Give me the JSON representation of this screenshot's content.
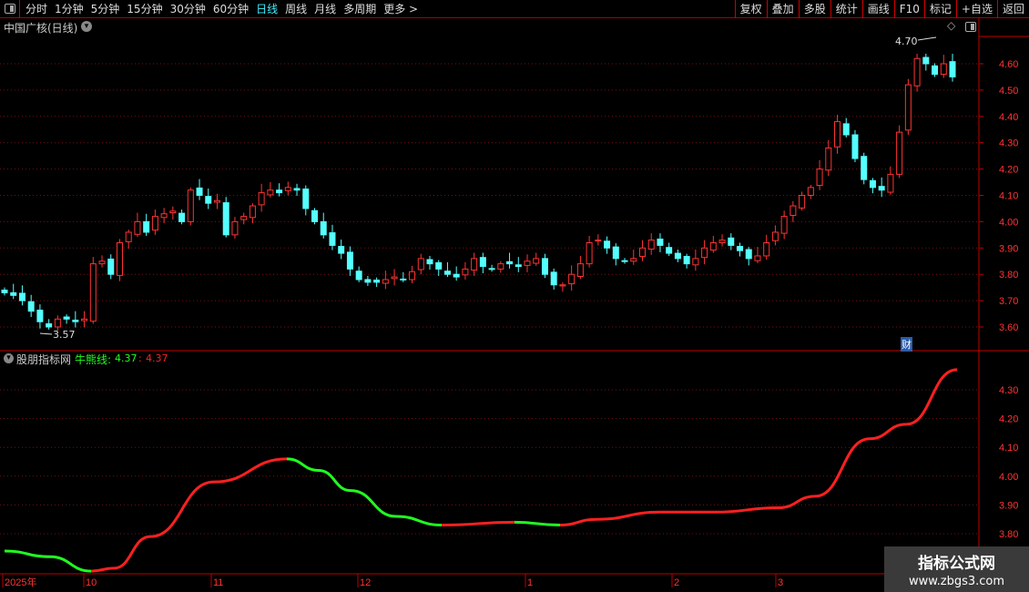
{
  "toolbar": {
    "periods": [
      "分时",
      "1分钟",
      "5分钟",
      "15分钟",
      "30分钟",
      "60分钟",
      "日线",
      "周线",
      "月线",
      "多周期",
      "更多 >"
    ],
    "active": "日线",
    "buttons": [
      "复权",
      "叠加",
      "多股",
      "统计",
      "画线",
      "F10",
      "标记",
      "+自选",
      "返回"
    ]
  },
  "main": {
    "title": "中国广核(日线)",
    "high_label": "4.70",
    "low_label": "3.57",
    "marker": "财"
  },
  "indicator": {
    "name": "股朋指标网",
    "line_label": "牛熊线:",
    "value_green": "4.37",
    "value_red": "4.37"
  },
  "watermark": {
    "line1": "指标公式网",
    "line2": "www.zbgs3.com"
  },
  "colors": {
    "up": "#ff3333",
    "down": "#54ffff",
    "bull": "#ff2020",
    "bear": "#20ff20",
    "axis": "#c00000"
  },
  "chart_data": {
    "type": "candlestick",
    "price_axis": {
      "ticks": [
        "4.60",
        "4.50",
        "4.40",
        "4.30",
        "4.20",
        "4.10",
        "4.00",
        "3.90",
        "3.80",
        "3.70",
        "3.60"
      ],
      "range": [
        3.56,
        4.72
      ]
    },
    "indicator_axis": {
      "ticks": [
        "4.30",
        "4.20",
        "4.10",
        "4.00",
        "3.90",
        "3.80"
      ],
      "range": [
        3.66,
        4.4
      ]
    },
    "time_labels": [
      "2025年",
      "10",
      "11",
      "12",
      "1",
      "2",
      "3"
    ],
    "closes": [
      3.73,
      3.72,
      3.7,
      3.66,
      3.62,
      3.6,
      3.63,
      3.63,
      3.62,
      3.63,
      3.84,
      3.85,
      3.8,
      3.92,
      3.96,
      4.0,
      3.96,
      4.02,
      4.03,
      4.04,
      4.0,
      4.12,
      4.1,
      4.07,
      4.08,
      3.95,
      4.0,
      4.02,
      4.06,
      4.11,
      4.12,
      4.11,
      4.13,
      4.12,
      4.05,
      4.0,
      3.95,
      3.91,
      3.88,
      3.82,
      3.78,
      3.77,
      3.77,
      3.78,
      3.79,
      3.78,
      3.81,
      3.86,
      3.84,
      3.82,
      3.8,
      3.79,
      3.82,
      3.86,
      3.83,
      3.82,
      3.84,
      3.84,
      3.83,
      3.85,
      3.86,
      3.8,
      3.76,
      3.76,
      3.8,
      3.84,
      3.92,
      3.93,
      3.9,
      3.86,
      3.85,
      3.86,
      3.9,
      3.93,
      3.91,
      3.88,
      3.86,
      3.84,
      3.86,
      3.9,
      3.92,
      3.93,
      3.91,
      3.89,
      3.86,
      3.87,
      3.92,
      3.96,
      4.02,
      4.06,
      4.1,
      4.13,
      4.2,
      4.28,
      4.38,
      4.33,
      4.24,
      4.16,
      4.13,
      4.12,
      4.18,
      4.34,
      4.52,
      4.62,
      4.6,
      4.56,
      4.6,
      4.55
    ],
    "indicator_line": [
      [
        0,
        3.74
      ],
      [
        50,
        3.72
      ],
      [
        95,
        3.67
      ],
      [
        120,
        3.68
      ],
      [
        160,
        3.79
      ],
      [
        230,
        3.98
      ],
      [
        310,
        4.06
      ],
      [
        345,
        4.02
      ],
      [
        380,
        3.95
      ],
      [
        430,
        3.86
      ],
      [
        480,
        3.83
      ],
      [
        560,
        3.84
      ],
      [
        610,
        3.83
      ],
      [
        650,
        3.85
      ],
      [
        720,
        3.875
      ],
      [
        780,
        3.875
      ],
      [
        850,
        3.89
      ],
      [
        890,
        3.93
      ],
      [
        950,
        4.13
      ],
      [
        990,
        4.18
      ],
      [
        1046,
        4.37
      ]
    ]
  }
}
